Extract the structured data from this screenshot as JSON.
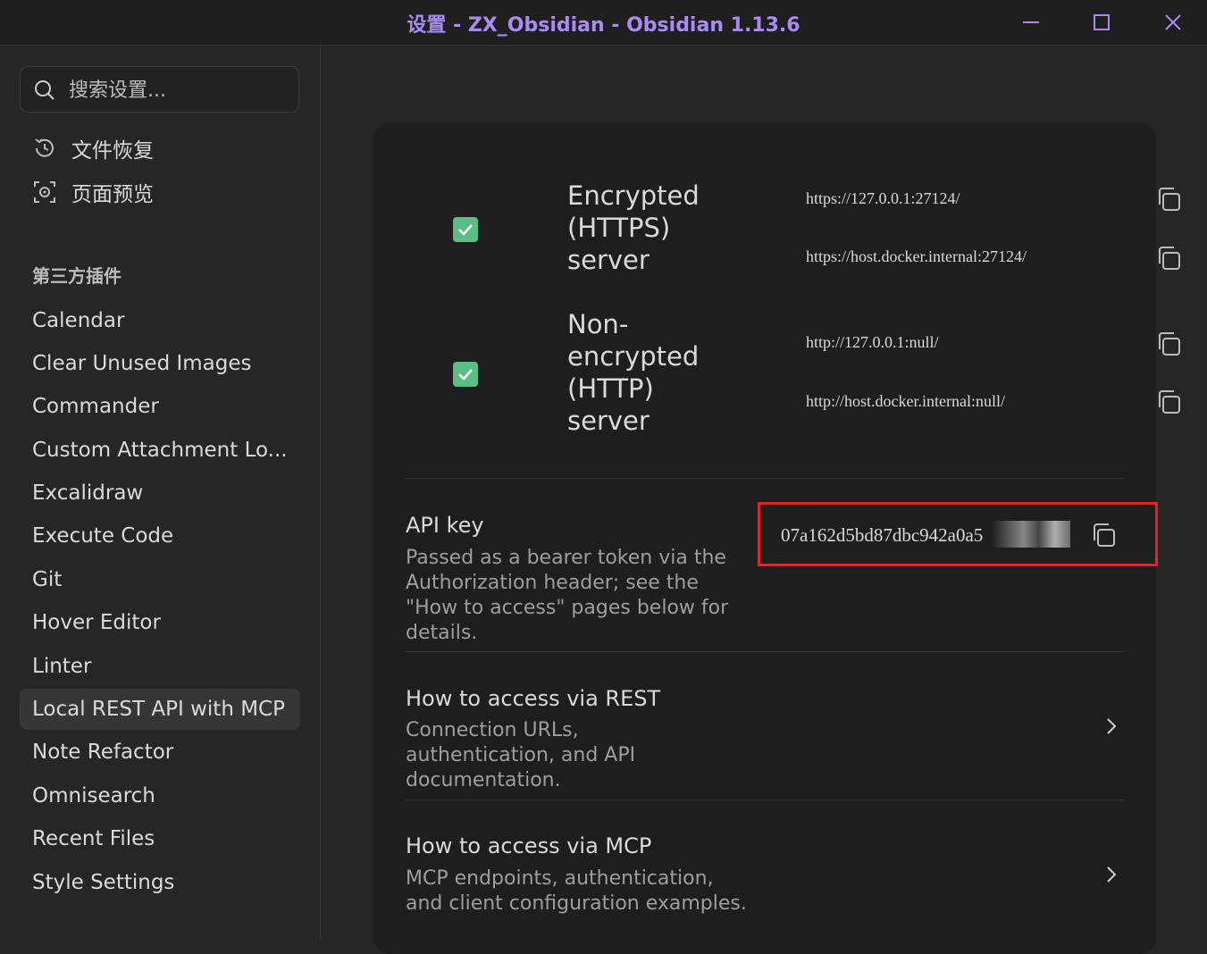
{
  "window": {
    "title": "设置 - ZX_Obsidian - Obsidian 1.13.6",
    "controls": [
      "minimize-icon",
      "maximize-icon",
      "close-icon"
    ]
  },
  "sidebar": {
    "search_placeholder": "搜索设置...",
    "core_items": [
      {
        "label": "文件恢复",
        "icon": "history-icon"
      },
      {
        "label": "页面预览",
        "icon": "preview-icon"
      }
    ],
    "group_title": "第三方插件",
    "plugins": [
      {
        "label": "Calendar"
      },
      {
        "label": "Clear Unused Images"
      },
      {
        "label": "Commander"
      },
      {
        "label": "Custom Attachment Lo..."
      },
      {
        "label": "Excalidraw"
      },
      {
        "label": "Execute Code"
      },
      {
        "label": "Git"
      },
      {
        "label": "Hover Editor"
      },
      {
        "label": "Linter"
      },
      {
        "label": "Local REST API with MCP",
        "active": true
      },
      {
        "label": "Note Refactor"
      },
      {
        "label": "Omnisearch"
      },
      {
        "label": "Recent Files"
      },
      {
        "label": "Style Settings"
      }
    ]
  },
  "servers": [
    {
      "enabled": true,
      "label_lines": [
        "Encrypted",
        "(HTTPS)",
        "server"
      ],
      "urls": [
        "https://127.0.0.1:27124/",
        "https://host.docker.internal:27124/"
      ]
    },
    {
      "enabled": true,
      "label_lines": [
        "Non-",
        "encrypted",
        "(HTTP)",
        "server"
      ],
      "urls": [
        "http://127.0.0.1:null/",
        "http://host.docker.internal:null/"
      ]
    }
  ],
  "api_key": {
    "name": "API key",
    "description": "Passed as a bearer token via the Authorization header; see the \"How to access\" pages below for details.",
    "value_visible": "07a162d5bd87dbc942a0a5",
    "highlight_color": "#e8202a"
  },
  "links": [
    {
      "name": "How to access via REST",
      "description": "Connection URLs, authentication, and API documentation."
    },
    {
      "name": "How to access via MCP",
      "description": "MCP endpoints, authentication, and client configuration examples."
    }
  ],
  "colors": {
    "accent": "#a98bf5",
    "checkbox": "#5bbe84",
    "background": "#262626",
    "panel": "#1e1e1e"
  }
}
